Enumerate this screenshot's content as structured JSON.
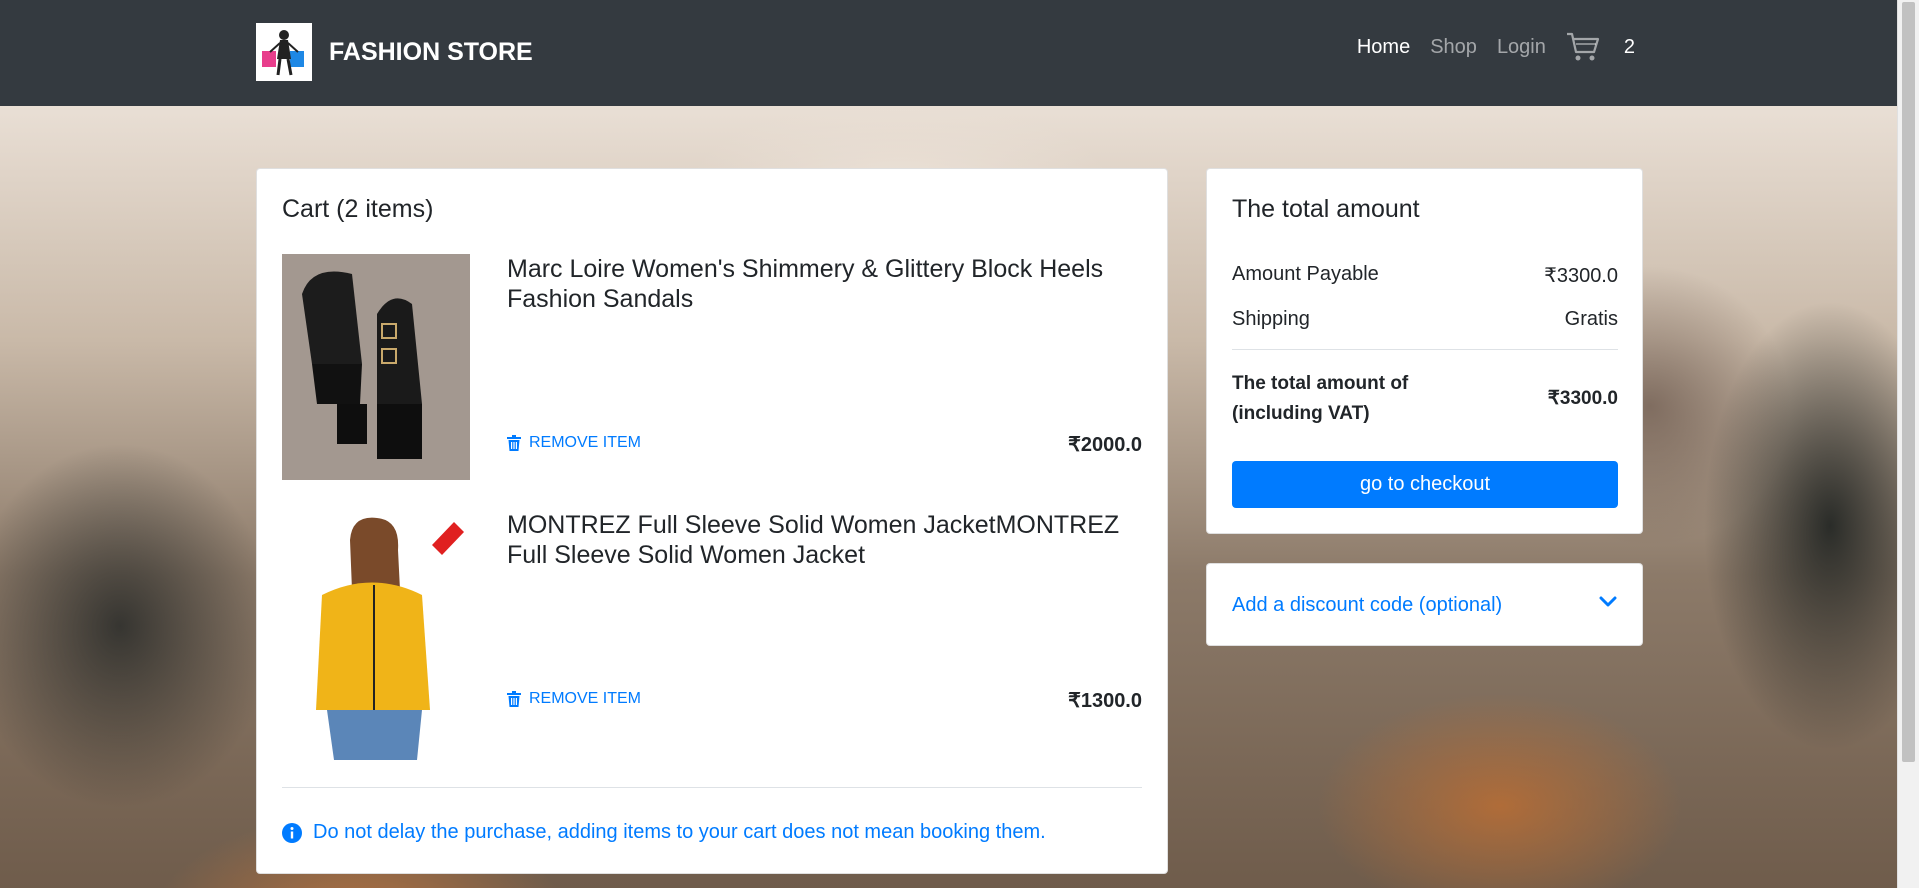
{
  "navbar": {
    "brand": "FASHION STORE",
    "links": [
      {
        "label": "Home",
        "active": true
      },
      {
        "label": "Shop",
        "active": false
      },
      {
        "label": "Login",
        "active": false
      }
    ],
    "cart_count": "2"
  },
  "cart": {
    "title": "Cart (2 items)",
    "items": [
      {
        "name": "Marc Loire Women's Shimmery & Glittery Block Heels Fashion Sandals",
        "remove_label": "REMOVE ITEM",
        "price": "₹2000.0",
        "image": "black block heel sandal"
      },
      {
        "name": "MONTREZ Full Sleeve Solid Women JacketMONTREZ Full Sleeve Solid Women Jacket",
        "remove_label": "REMOVE ITEM",
        "price": "₹1300.0",
        "image": "yellow women jacket"
      }
    ],
    "notice": "Do not delay the purchase, adding items to your cart does not mean booking them."
  },
  "summary": {
    "title": "The total amount",
    "amount_payable_label": "Amount Payable",
    "amount_payable_value": "₹3300.0",
    "shipping_label": "Shipping",
    "shipping_value": "Gratis",
    "total_label_line1": "The total amount of",
    "total_label_line2": "(including VAT)",
    "total_value": "₹3300.0",
    "checkout_label": "go to checkout"
  },
  "discount": {
    "label": "Add a discount code (optional)"
  },
  "colors": {
    "navbar": "#343a40",
    "primary": "#007bff"
  }
}
